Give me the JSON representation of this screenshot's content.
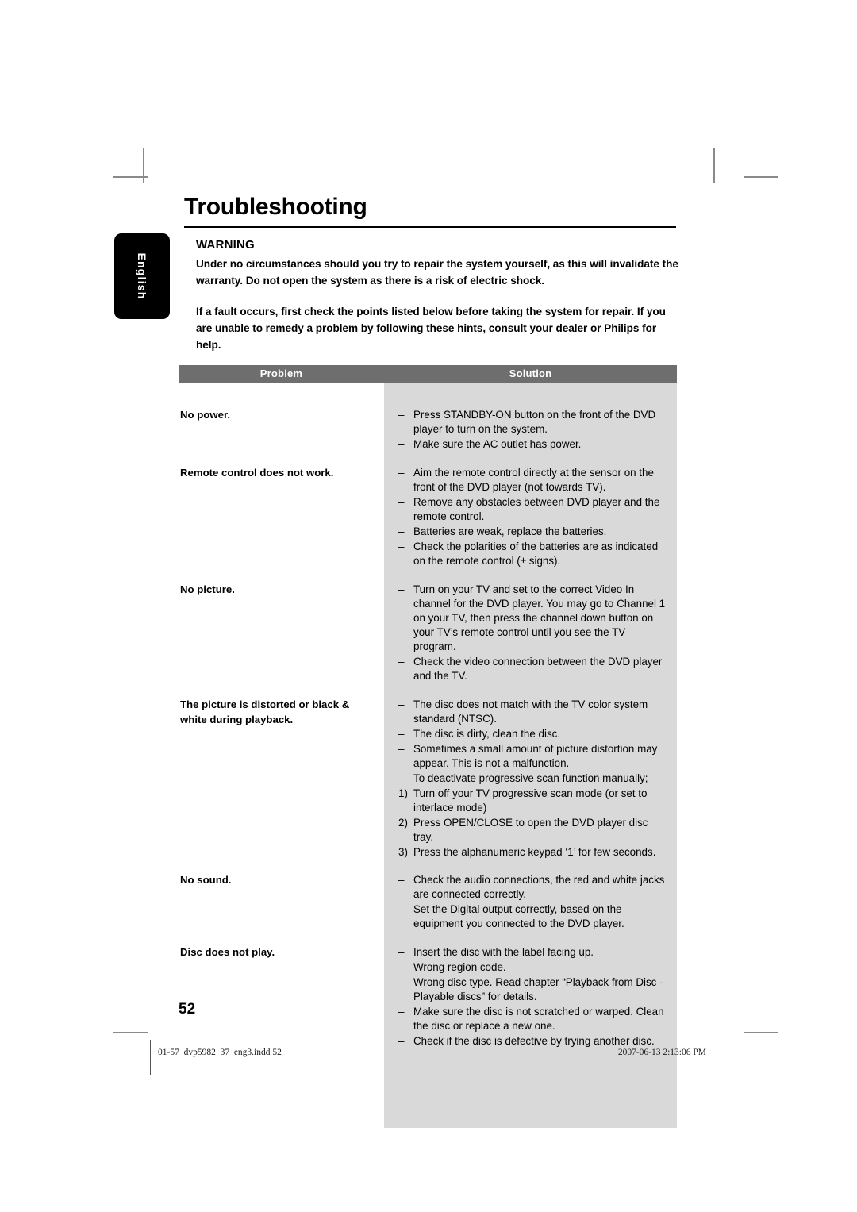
{
  "page": {
    "title": "Troubleshooting",
    "language_tab": "English",
    "page_number": "52"
  },
  "warning": {
    "heading": "WARNING",
    "paragraph_1": "Under no circumstances should you try to repair the system yourself, as this will invalidate the warranty. Do not open the system as there is a risk of electric shock.",
    "paragraph_2": "If a fault occurs, first check the points listed below before taking the system for repair. If you are unable to remedy a problem by following these hints, consult your dealer or Philips for help."
  },
  "table": {
    "headers": {
      "problem": "Problem",
      "solution": "Solution"
    },
    "rows": [
      {
        "problem": "No power.",
        "solutions": [
          {
            "marker": "–",
            "text": "Press STANDBY-ON button on the front of the DVD player to turn on the system."
          },
          {
            "marker": "–",
            "text": "Make sure the AC outlet has power."
          }
        ]
      },
      {
        "problem": "Remote control does not work.",
        "solutions": [
          {
            "marker": "–",
            "text": "Aim the remote control directly at the sensor on the front of the DVD player (not towards TV)."
          },
          {
            "marker": "–",
            "text": "Remove any obstacles between DVD player and the remote control."
          },
          {
            "marker": "–",
            "text": "Batteries are weak, replace the batteries."
          },
          {
            "marker": "–",
            "text": "Check the polarities of the batteries are as indicated on the remote control (± signs)."
          }
        ]
      },
      {
        "problem": "No picture.",
        "solutions": [
          {
            "marker": "–",
            "text": "Turn on your TV and set to the correct Video In channel for the DVD player. You may go to Channel 1 on your TV, then press the channel down button on your TV’s remote control until you see the TV program."
          },
          {
            "marker": "–",
            "text": "Check the video connection between the DVD player and the TV."
          }
        ]
      },
      {
        "problem": "The picture is distorted or black & white during playback.",
        "solutions": [
          {
            "marker": "–",
            "text": "The disc does not match with the TV color system standard (NTSC)."
          },
          {
            "marker": "–",
            "text": "The disc is dirty, clean the disc."
          },
          {
            "marker": "–",
            "text": "Sometimes a small amount of picture distortion may appear. This is not a malfunction."
          },
          {
            "marker": "–",
            "text": "To deactivate progressive scan function manually;"
          },
          {
            "marker": "1)",
            "text": "Turn off your TV progressive scan mode (or set to interlace mode)"
          },
          {
            "marker": "2)",
            "text": "Press OPEN/CLOSE to open the DVD player disc tray."
          },
          {
            "marker": "3)",
            "text": "Press the alphanumeric keypad ‘1’ for few seconds."
          }
        ]
      },
      {
        "problem": "No sound.",
        "solutions": [
          {
            "marker": "–",
            "text": "Check the audio connections, the red and white jacks are connected correctly."
          },
          {
            "marker": "–",
            "text": "Set the Digital output correctly, based on the equipment you connected to the DVD player."
          }
        ]
      },
      {
        "problem": "Disc does not play.",
        "solutions": [
          {
            "marker": "–",
            "text": "Insert the disc with the label facing up."
          },
          {
            "marker": "–",
            "text": "Wrong region code."
          },
          {
            "marker": "–",
            "text": "Wrong disc type. Read chapter “Playback from Disc - Playable discs” for details."
          },
          {
            "marker": "–",
            "text": "Make sure the disc is not scratched or warped. Clean the disc or replace a new one."
          },
          {
            "marker": "–",
            "text": "Check if the disc is defective by trying another disc."
          }
        ]
      }
    ]
  },
  "footer": {
    "file_name": "01-57_dvp5982_37_eng3.indd   52",
    "timestamp": "2007-06-13   2:13:06 PM"
  },
  "colors": {
    "table_header_bg": "#6e6e6e",
    "solution_column_bg": "#d9d9d9",
    "tab_bg": "#000000"
  }
}
